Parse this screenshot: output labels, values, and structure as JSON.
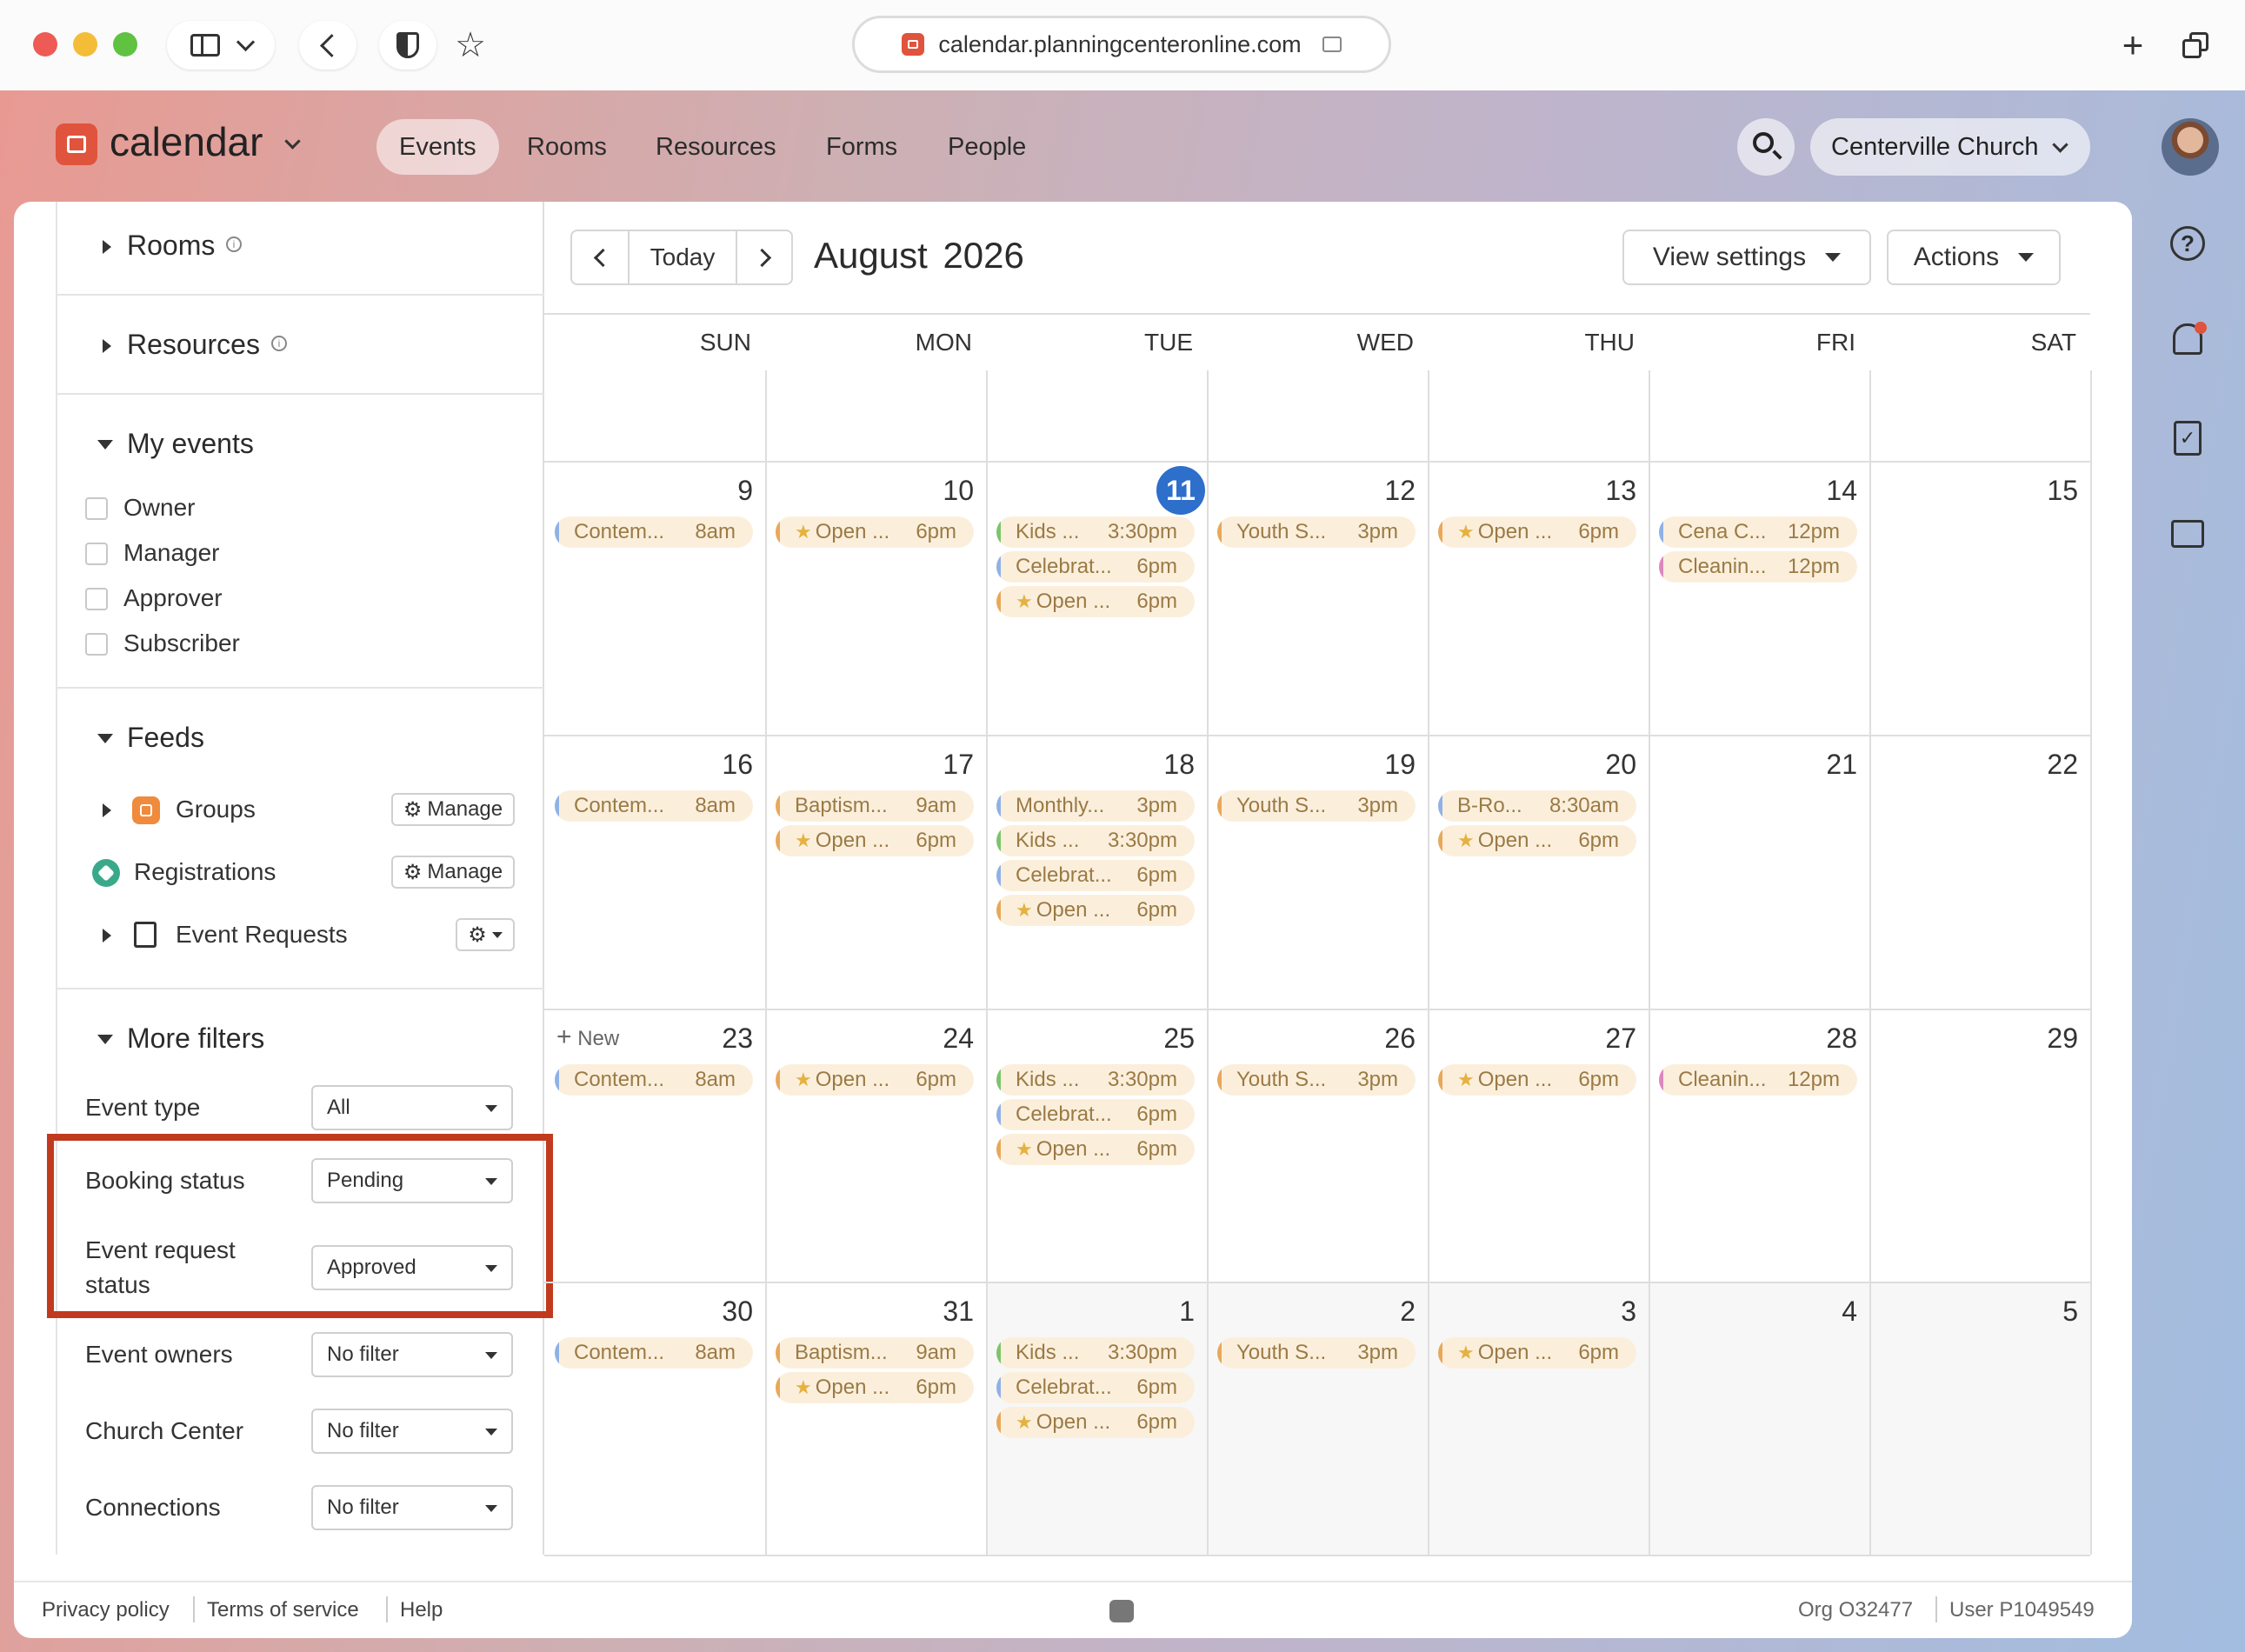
{
  "browser": {
    "url": "calendar.planningcenteronline.com"
  },
  "app": {
    "name": "calendar",
    "org_selector": "Centerville Church",
    "nav": [
      "Events",
      "Rooms",
      "Resources",
      "Forms",
      "People"
    ]
  },
  "sidebar": {
    "rooms": "Rooms",
    "resources": "Resources",
    "my_events": {
      "title": "My events",
      "items": [
        "Owner",
        "Manager",
        "Approver",
        "Subscriber"
      ]
    },
    "feeds": {
      "title": "Feeds",
      "groups": "Groups",
      "registrations": "Registrations",
      "event_requests": "Event Requests",
      "manage_label": "Manage"
    },
    "more_filters": {
      "title": "More filters",
      "filters": [
        {
          "label": "Event type",
          "value": "All"
        },
        {
          "label": "Booking status",
          "value": "Pending"
        },
        {
          "label": "Event request status",
          "value": "Approved"
        },
        {
          "label": "Event owners",
          "value": "No filter"
        },
        {
          "label": "Church Center",
          "value": "No filter"
        },
        {
          "label": "Connections",
          "value": "No filter"
        }
      ]
    }
  },
  "calendar": {
    "today_label": "Today",
    "month": "August",
    "year": "2026",
    "view_settings": "View settings",
    "actions": "Actions",
    "new_label": "New",
    "weekdays": [
      "SUN",
      "MON",
      "TUE",
      "WED",
      "THU",
      "FRI",
      "SAT"
    ],
    "days": {
      "row1": [
        "9",
        "10",
        "11",
        "12",
        "13",
        "14",
        "15"
      ],
      "row2": [
        "16",
        "17",
        "18",
        "19",
        "20",
        "21",
        "22"
      ],
      "row3": [
        "23",
        "24",
        "25",
        "26",
        "27",
        "28",
        "29"
      ],
      "row4": [
        "30",
        "31",
        "1",
        "2",
        "3",
        "4",
        "5"
      ]
    },
    "events": {
      "d9": [
        {
          "title": "Contem...",
          "time": "8am"
        }
      ],
      "d10": [
        {
          "title": "Open ...",
          "time": "6pm"
        }
      ],
      "d11": [
        {
          "title": "Kids ...",
          "time": "3:30pm"
        },
        {
          "title": "Celebrat...",
          "time": "6pm"
        },
        {
          "title": "Open ...",
          "time": "6pm"
        }
      ],
      "d12": [
        {
          "title": "Youth S...",
          "time": "3pm"
        }
      ],
      "d13": [
        {
          "title": "Open ...",
          "time": "6pm"
        }
      ],
      "d14": [
        {
          "title": "Cena C...",
          "time": "12pm"
        },
        {
          "title": "Cleanin...",
          "time": "12pm"
        }
      ],
      "d16": [
        {
          "title": "Contem...",
          "time": "8am"
        }
      ],
      "d17": [
        {
          "title": "Baptism...",
          "time": "9am"
        },
        {
          "title": "Open ...",
          "time": "6pm"
        }
      ],
      "d18": [
        {
          "title": "Monthly...",
          "time": "3pm"
        },
        {
          "title": "Kids ...",
          "time": "3:30pm"
        },
        {
          "title": "Celebrat...",
          "time": "6pm"
        },
        {
          "title": "Open ...",
          "time": "6pm"
        }
      ],
      "d19": [
        {
          "title": "Youth S...",
          "time": "3pm"
        }
      ],
      "d20": [
        {
          "title": "B-Ro...",
          "time": "8:30am"
        },
        {
          "title": "Open ...",
          "time": "6pm"
        }
      ],
      "d23": [
        {
          "title": "Contem...",
          "time": "8am"
        }
      ],
      "d24": [
        {
          "title": "Open ...",
          "time": "6pm"
        }
      ],
      "d25": [
        {
          "title": "Kids ...",
          "time": "3:30pm"
        },
        {
          "title": "Celebrat...",
          "time": "6pm"
        },
        {
          "title": "Open ...",
          "time": "6pm"
        }
      ],
      "d26": [
        {
          "title": "Youth S...",
          "time": "3pm"
        }
      ],
      "d27": [
        {
          "title": "Open ...",
          "time": "6pm"
        }
      ],
      "d28": [
        {
          "title": "Cleanin...",
          "time": "12pm"
        }
      ],
      "d30": [
        {
          "title": "Contem...",
          "time": "8am"
        }
      ],
      "d31": [
        {
          "title": "Baptism...",
          "time": "9am"
        },
        {
          "title": "Open ...",
          "time": "6pm"
        }
      ],
      "d1": [
        {
          "title": "Kids ...",
          "time": "3:30pm"
        },
        {
          "title": "Celebrat...",
          "time": "6pm"
        },
        {
          "title": "Open ...",
          "time": "6pm"
        }
      ],
      "d2": [
        {
          "title": "Youth S...",
          "time": "3pm"
        }
      ],
      "d3": [
        {
          "title": "Open ...",
          "time": "6pm"
        }
      ]
    }
  },
  "footer": {
    "privacy": "Privacy policy",
    "terms": "Terms of service",
    "help": "Help",
    "org": "Org O32477",
    "user": "User P1049549"
  },
  "colors": {
    "accent_red": "#e0533d",
    "today_blue": "#2d6fcb",
    "highlight_box": "#c13a1e"
  }
}
